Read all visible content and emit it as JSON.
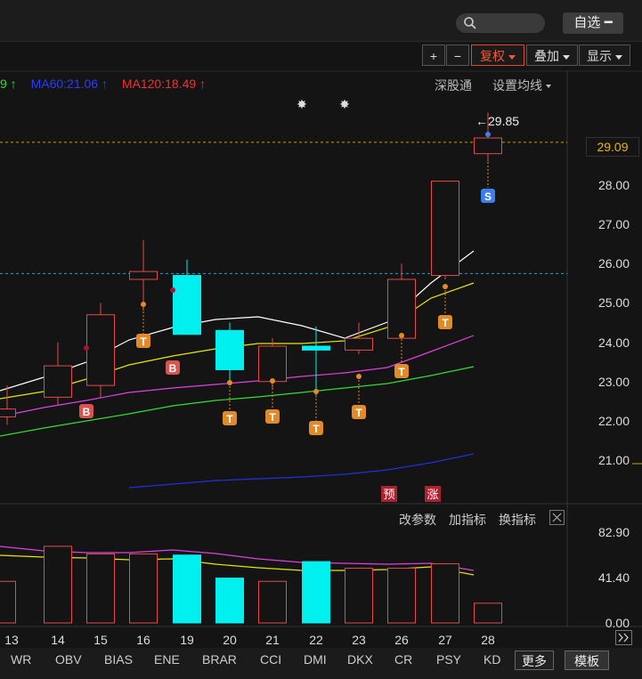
{
  "header": {
    "watchlist_label": "自选",
    "watchlist_symbol": "━"
  },
  "toolbar": {
    "plus": "+",
    "minus": "−",
    "fuquan": "复权",
    "overlay": "叠加",
    "display": "显示"
  },
  "ma_legend": {
    "partial": "9 ↑",
    "ma60": "MA60:21.06 ↑",
    "ma120": "MA120:18.49 ↑",
    "colors": {
      "partial": "#33dd33",
      "ma60": "#2c3cff",
      "ma120": "#ee3333"
    }
  },
  "links": {
    "shenguton": "深股通",
    "set_ma": "设置均线"
  },
  "price_panel": {
    "high_annotation": "←29.85",
    "current_price_tag": "29.09",
    "y_labels": [
      "28.00",
      "27.00",
      "26.00",
      "25.00",
      "24.00",
      "23.00",
      "22.00",
      "21.00"
    ],
    "signal_S": "S",
    "forecast_badge": "预",
    "limit_up_badge": "涨"
  },
  "volume_panel": {
    "change_params": "改参数",
    "add_indicator": "加指标",
    "switch_indicator": "换指标",
    "y_labels": [
      "82.90",
      "41.40",
      "0.00"
    ]
  },
  "x_axis": {
    "labels": [
      "13",
      "14",
      "15",
      "16",
      "19",
      "20",
      "21",
      "22",
      "23",
      "26",
      "27",
      "28"
    ]
  },
  "bottom_tabs": {
    "items": [
      "WR",
      "OBV",
      "BIAS",
      "ENE",
      "BRAR",
      "CCI",
      "DMI",
      "DKX",
      "CR",
      "PSY",
      "KD"
    ],
    "more": "更多",
    "template": "模板"
  },
  "chart_data": {
    "type": "candlestick",
    "categories": [
      "13",
      "14",
      "15",
      "16",
      "19",
      "20",
      "21",
      "22",
      "23",
      "26",
      "27",
      "28"
    ],
    "ohlc": [
      {
        "x": "13",
        "open": 22.1,
        "high": 22.9,
        "low": 21.9,
        "close": 22.3
      },
      {
        "x": "14",
        "open": 22.6,
        "high": 24.0,
        "low": 22.4,
        "close": 23.4
      },
      {
        "x": "15",
        "open": 22.9,
        "high": 25.0,
        "low": 22.6,
        "close": 24.7
      },
      {
        "x": "16",
        "open": 25.6,
        "high": 26.6,
        "low": 24.8,
        "close": 25.8
      },
      {
        "x": "19",
        "open": 25.7,
        "high": 26.1,
        "low": 24.5,
        "close": 24.2
      },
      {
        "x": "20",
        "open": 24.3,
        "high": 24.5,
        "low": 23.0,
        "close": 23.3
      },
      {
        "x": "21",
        "open": 23.0,
        "high": 24.1,
        "low": 22.8,
        "close": 23.9
      },
      {
        "x": "22",
        "open": 23.9,
        "high": 24.4,
        "low": 22.6,
        "close": 23.8
      },
      {
        "x": "23",
        "open": 23.8,
        "high": 24.5,
        "low": 23.7,
        "close": 24.1
      },
      {
        "x": "26",
        "open": 24.1,
        "high": 26.0,
        "low": 24.1,
        "close": 25.6
      },
      {
        "x": "27",
        "open": 25.7,
        "high": 28.1,
        "low": 25.6,
        "close": 28.1
      },
      {
        "x": "28",
        "open": 28.8,
        "high": 29.85,
        "low": 28.6,
        "close": 29.2
      }
    ],
    "volume": [
      38,
      70,
      63,
      63,
      62,
      41,
      38,
      56,
      50,
      50,
      54,
      18
    ],
    "ylim": [
      20.5,
      30.2
    ],
    "volume_ylim": [
      0,
      82.9
    ],
    "dashed_levels": [
      29.09,
      25.75
    ],
    "colors": {
      "up": "#e34a4a",
      "down": "#00f0f0",
      "ma5": "#ffffff",
      "ma10": "#e6e600",
      "ma20": "#e040e0",
      "ma30": "#33dd33",
      "ma60": "#2030e0"
    }
  }
}
